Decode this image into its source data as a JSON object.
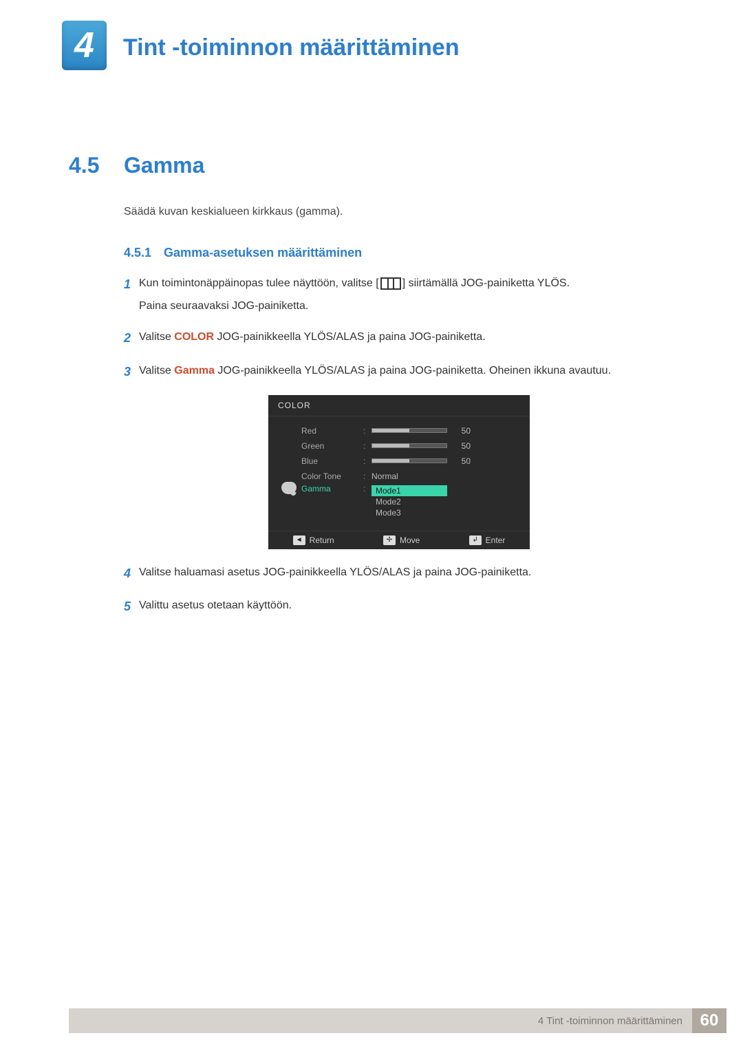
{
  "chapter": {
    "number": "4",
    "title": "Tint -toiminnon määrittäminen"
  },
  "section": {
    "number": "4.5",
    "title": "Gamma"
  },
  "intro": "Säädä kuvan keskialueen kirkkaus (gamma).",
  "subsection": {
    "number": "4.5.1",
    "title": "Gamma-asetuksen määrittäminen"
  },
  "steps": {
    "s1a": "Kun toimintonäppäinopas tulee näyttöön, valitse [",
    "s1b": "] siirtämällä JOG-painiketta YLÖS.",
    "s1c": "Paina seuraavaksi JOG-painiketta.",
    "s2a": "Valitse ",
    "s2_color": "COLOR",
    "s2b": " JOG-painikkeella YLÖS/ALAS ja paina JOG-painiketta.",
    "s3a": "Valitse ",
    "s3_gamma": "Gamma",
    "s3b": " JOG-painikkeella YLÖS/ALAS ja paina JOG-painiketta. Oheinen ikkuna avautuu.",
    "s4": "Valitse haluamasi asetus JOG-painikkeella YLÖS/ALAS ja paina JOG-painiketta.",
    "s5": "Valittu asetus otetaan käyttöön."
  },
  "nums": {
    "n1": "1",
    "n2": "2",
    "n3": "3",
    "n4": "4",
    "n5": "5"
  },
  "osd": {
    "title": "COLOR",
    "rows": {
      "red": {
        "label": "Red",
        "value": "50"
      },
      "green": {
        "label": "Green",
        "value": "50"
      },
      "blue": {
        "label": "Blue",
        "value": "50"
      },
      "colortone": {
        "label": "Color Tone",
        "value": "Normal"
      },
      "gamma": {
        "label": "Gamma"
      }
    },
    "options": {
      "m1": "Mode1",
      "m2": "Mode2",
      "m3": "Mode3"
    },
    "footer": {
      "return": "Return",
      "move": "Move",
      "enter": "Enter"
    },
    "keys": {
      "return": "◄",
      "move": "✢",
      "enter": "↲"
    }
  },
  "footer": {
    "label": "4 Tint -toiminnon määrittäminen",
    "page": "60"
  }
}
